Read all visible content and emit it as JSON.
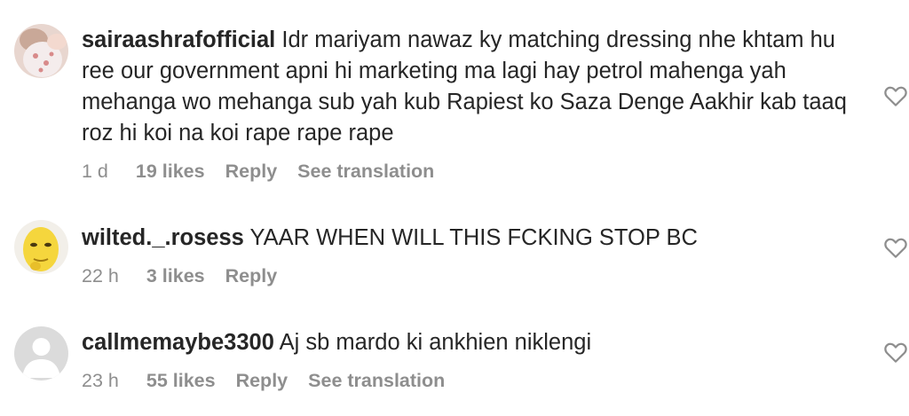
{
  "comments": [
    {
      "username": "sairaashrafofficial",
      "text": "Idr mariyam nawaz ky matching dressing nhe khtam hu ree our government apni hi marketing ma lagi hay petrol mahenga yah mehanga wo mehanga sub yah kub Rapiest ko Saza Denge Aakhir kab taaq roz hi koi na koi rape rape rape",
      "time": "1 d",
      "likes": "19 likes",
      "reply_label": "Reply",
      "translate_label": "See translation",
      "avatar_icon": "profile-photo-baby",
      "like_icon": "heart-outline-icon"
    },
    {
      "username": "wilted._.rosess",
      "text": "YAAR WHEN WILL THIS FCKING STOP BC",
      "time": "22 h",
      "likes": "3 likes",
      "reply_label": "Reply",
      "avatar_icon": "profile-photo-yellow-emoji",
      "like_icon": "heart-outline-icon"
    },
    {
      "username": "callmemaybe3300",
      "text": "Aj sb mardo ki ankhien niklengi",
      "time": "23 h",
      "likes": "55 likes",
      "reply_label": "Reply",
      "translate_label": "See translation",
      "avatar_icon": "default-avatar-icon",
      "like_icon": "heart-outline-icon"
    }
  ],
  "colors": {
    "primary_text": "#262626",
    "secondary_text": "#8e8e8e",
    "background": "#ffffff",
    "default_avatar_bg": "#dbdbdb",
    "default_avatar_fg": "#ffffff"
  }
}
